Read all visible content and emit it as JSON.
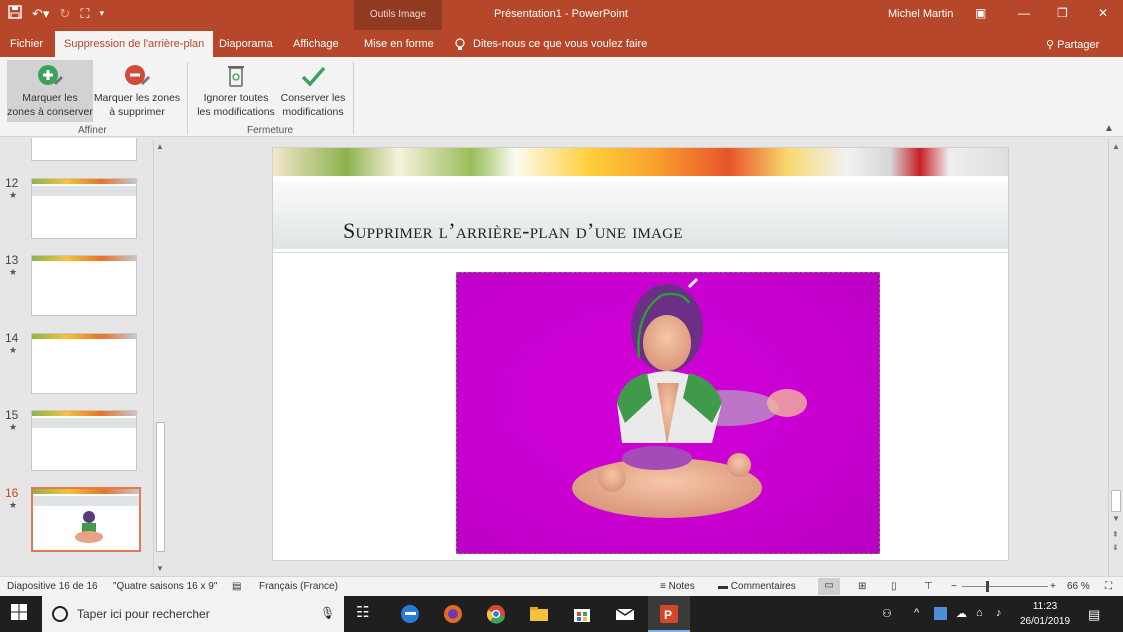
{
  "titlebar": {
    "context_label": "Outils Image",
    "title": "Présentation1  -  PowerPoint",
    "user": "Michel Martin"
  },
  "tabs": {
    "fichier": "Fichier",
    "bg_removal": "Suppression de l'arrière-plan",
    "diaporama": "Diaporama",
    "affichage": "Affichage",
    "mise_en_forme": "Mise en forme",
    "tellme": "Dites-nous ce que vous voulez faire",
    "share": "Partager"
  },
  "ribbon": {
    "mark_keep_l1": "Marquer les",
    "mark_keep_l2": "zones à conserver",
    "mark_remove_l1": "Marquer les zones",
    "mark_remove_l2": "à supprimer",
    "group_affiner": "Affiner",
    "discard_l1": "Ignorer toutes",
    "discard_l2": "les modifications",
    "keep_l1": "Conserver les",
    "keep_l2": "modifications",
    "group_fermeture": "Fermeture"
  },
  "slides": [
    {
      "num": "12",
      "star": "★"
    },
    {
      "num": "13",
      "star": "★"
    },
    {
      "num": "14",
      "star": "★"
    },
    {
      "num": "15",
      "star": "★"
    },
    {
      "num": "16",
      "star": "★"
    }
  ],
  "slide": {
    "title": "Supprimer l’arrière-plan d’une image"
  },
  "status": {
    "slide_counter": "Diapositive 16 de 16",
    "theme": "\"Quatre saisons 16 x 9\"",
    "language": "Français (France)",
    "notes": "Notes",
    "comments": "Commentaires",
    "zoom": "66 %",
    "zoom_fraction": 0.66
  },
  "taskbar": {
    "search_placeholder": "Taper ici pour rechercher",
    "time": "11:23",
    "date": "26/01/2019"
  },
  "colors": {
    "accent": "#b7472a",
    "photo_bg": "#c900d0"
  }
}
